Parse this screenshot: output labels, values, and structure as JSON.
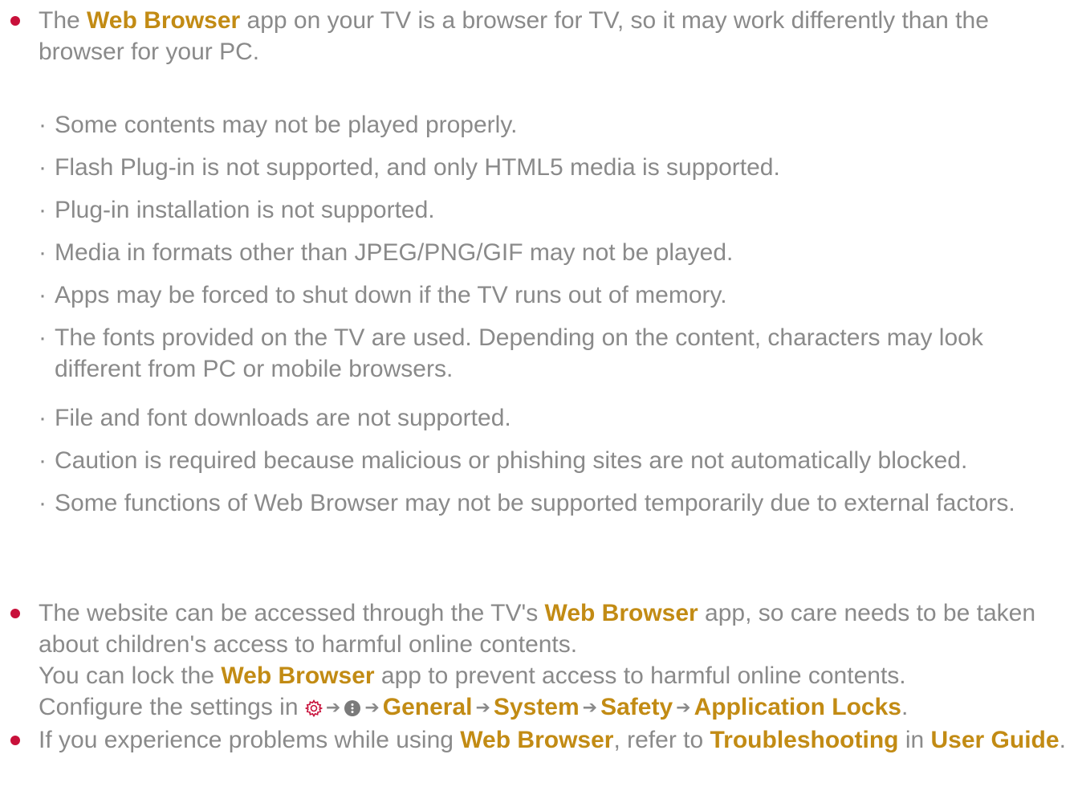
{
  "colors": {
    "accent": "#c28b14",
    "bullet": "#c8103a",
    "text": "#8a8a8a"
  },
  "bullet1": {
    "pre": "The ",
    "hl": "Web Browser",
    "post": " app on your TV is a browser for TV, so it may work differently than the browser for your PC."
  },
  "sub_marker": "·",
  "subitems": [
    "Some contents may not be played properly.",
    "Flash Plug-in is not supported, and only HTML5 media is supported.",
    "Plug-in installation is not supported.",
    "Media in formats other than JPEG/PNG/GIF may not be played.",
    "Apps may be forced to shut down if the TV runs out of memory.",
    "The fonts provided on the TV are used. Depending on the content, characters may look different from PC or mobile browsers.",
    "File and font downloads are not supported.",
    "Caution is required because malicious or phishing sites are not automatically blocked.",
    "Some functions of Web Browser may not be supported temporarily due to external factors."
  ],
  "bullet2": {
    "line1_pre": "The website can be accessed through the TV's ",
    "line1_hl": "Web Browser",
    "line1_post": " app, so care needs to be taken about children's access to harmful online contents.",
    "line2_pre": "You can lock the ",
    "line2_hl": "Web Browser",
    "line2_post": " app to prevent access to harmful online contents.",
    "line3_pre": "Configure the settings in ",
    "icons": [
      "gear-icon",
      "more-icon"
    ],
    "arrow": "➔",
    "path": [
      "General",
      "System",
      "Safety",
      "Application Locks"
    ],
    "end": "."
  },
  "bullet3": {
    "pre": "If you experience problems while using ",
    "hl1": "Web Browser",
    "mid": ", refer to ",
    "hl2": "Troubleshooting",
    "mid2": " in ",
    "hl3": "User Guide",
    "end": "."
  }
}
